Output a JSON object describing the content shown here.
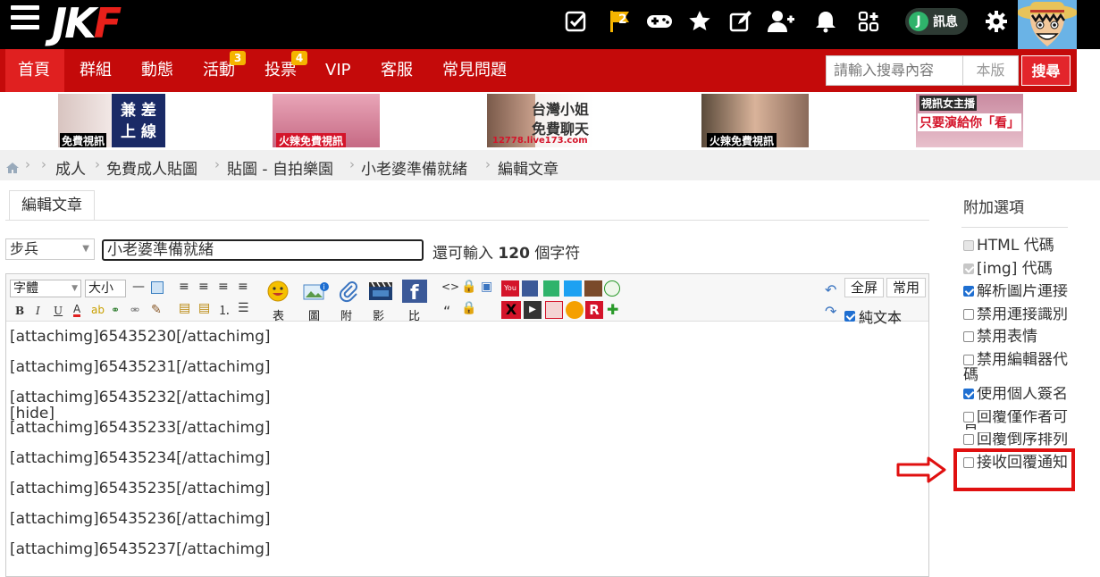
{
  "top_bar": {
    "logo_left": "JK",
    "logo_right": "F",
    "icons": [
      "checklist-icon",
      "flag-icon",
      "gamepad-icon",
      "star-icon",
      "edit-icon",
      "add-user-icon",
      "bell-icon",
      "apps-icon"
    ],
    "flag_badge": "2",
    "message_label": "訊息",
    "message_letter": "J"
  },
  "nav": {
    "items": [
      {
        "label": "首頁",
        "active": true
      },
      {
        "label": "群組"
      },
      {
        "label": "動態"
      },
      {
        "label": "活動",
        "badge": "3"
      },
      {
        "label": "投票",
        "badge": "4"
      },
      {
        "label": "VIP"
      },
      {
        "label": "客服"
      },
      {
        "label": "常見問題"
      }
    ],
    "search_placeholder": "請輸入搜尋內容",
    "search_scope": "本版",
    "search_button": "搜尋"
  },
  "banners": [
    {
      "line1": "兼 差",
      "line2": "上 線",
      "caption": "免費視訊"
    },
    {
      "caption": "火辣免費視訊"
    },
    {
      "line1": "台灣小姐",
      "line2": "免費聊天",
      "caption": "12778.live173.com"
    },
    {
      "caption": "火辣免費視訊"
    },
    {
      "line1": "視訊女主播",
      "line2": "只要演給你「看」"
    }
  ],
  "breadcrumb": [
    "成人",
    "免費成人貼圖",
    "貼圖 - 自拍樂園",
    "小老婆準備就緒",
    "編輯文章"
  ],
  "editor": {
    "tab_label": "編輯文章",
    "rank": "步兵",
    "title_value": "小老婆準備就緒",
    "char_prefix": "還可輸入",
    "char_count": "120",
    "char_suffix": "個字符",
    "toolbar": {
      "font": "字體",
      "size": "大小",
      "labels": [
        "表",
        "圖",
        "附",
        "影",
        "比"
      ],
      "fullscreen": "全屏",
      "common": "常用",
      "plain_text": "純文本"
    },
    "content_lines": [
      "[attachimg]65435230[/attachimg]",
      "[attachimg]65435231[/attachimg]",
      "[attachimg]65435232[/attachimg]",
      "[hide]",
      "[attachimg]65435233[/attachimg]",
      "[attachimg]65435234[/attachimg]",
      "[attachimg]65435235[/attachimg]",
      "[attachimg]65435236[/attachimg]",
      "[attachimg]65435237[/attachimg]"
    ]
  },
  "options": {
    "title": "附加選項",
    "items": [
      {
        "label": "HTML 代碼",
        "checked": false,
        "disabled": true
      },
      {
        "label": "[img] 代碼",
        "checked": true,
        "disabled": true
      },
      {
        "label": "解析圖片連接",
        "checked": true
      },
      {
        "label": "禁用連接識別",
        "checked": false
      },
      {
        "label": "禁用表情",
        "checked": false
      },
      {
        "label": "禁用編輯器代碼",
        "checked": false
      },
      {
        "label": "使用個人簽名",
        "checked": true
      },
      {
        "label": "回覆僅作者可見",
        "checked": false
      },
      {
        "label": "回覆倒序排列",
        "checked": false
      },
      {
        "label": "接收回覆通知",
        "checked": false
      }
    ]
  },
  "colors": {
    "nav_red": "#c40a0a",
    "highlight_red": "#e01010",
    "checkbox_blue": "#1f6fd1"
  }
}
